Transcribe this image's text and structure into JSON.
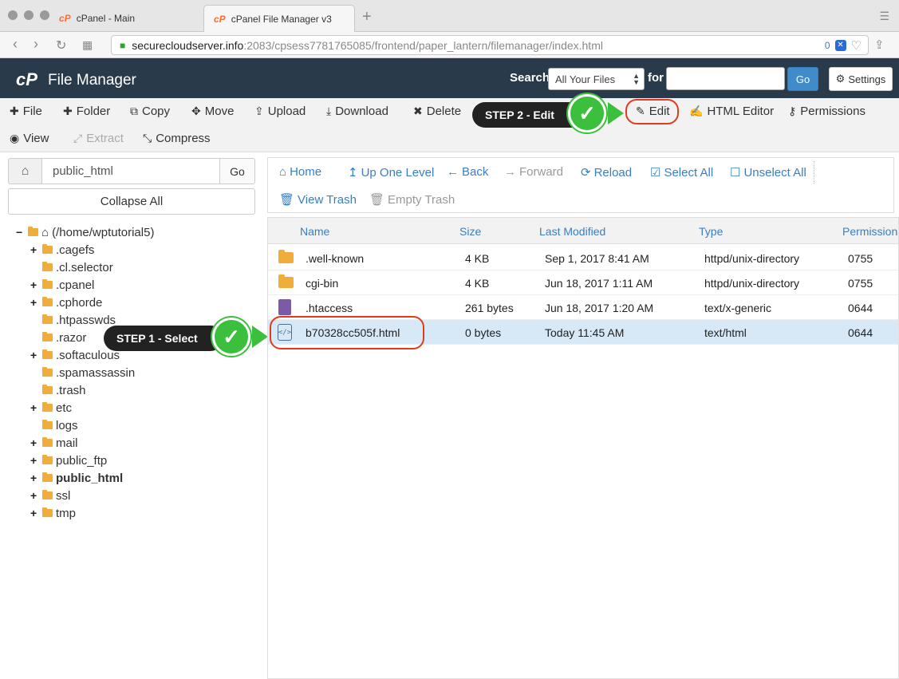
{
  "browser": {
    "tabs": [
      {
        "label": "cPanel - Main",
        "favicon": "cP"
      },
      {
        "label": "cPanel File Manager v3",
        "favicon": "cP",
        "close": "✕"
      }
    ],
    "new_tab": "+",
    "url_host": "securecloudserver.info",
    "url_path": ":2083/cpsess7781765085/frontend/paper_lantern/filemanager/index.html",
    "tracker_count": "0"
  },
  "header": {
    "logo": "cP",
    "title": "File Manager",
    "search_label": "Search",
    "search_scope": "All Your Files",
    "for_label": "for",
    "search_value": "",
    "go_label": "Go",
    "settings_label": "Settings"
  },
  "toolbar": {
    "file": "File",
    "folder": "Folder",
    "copy": "Copy",
    "move": "Move",
    "upload": "Upload",
    "download": "Download",
    "delete": "Delete",
    "edit": "Edit",
    "html_editor": "HTML Editor",
    "permissions": "Permissions",
    "view": "View",
    "extract": "Extract",
    "compress": "Compress"
  },
  "steps": {
    "step1": "STEP 1 - Select",
    "step2": "STEP 2 - Edit"
  },
  "left": {
    "path_value": "public_html",
    "go_label": "Go",
    "collapse_label": "Collapse All",
    "root": "(/home/wptutorial5)",
    "tree": [
      {
        "label": ".cagefs",
        "toggle": "+"
      },
      {
        "label": ".cl.selector",
        "toggle": ""
      },
      {
        "label": ".cpanel",
        "toggle": "+"
      },
      {
        "label": ".cphorde",
        "toggle": "+"
      },
      {
        "label": ".htpasswds",
        "toggle": ""
      },
      {
        "label": ".razor",
        "toggle": ""
      },
      {
        "label": ".softaculous",
        "toggle": "+"
      },
      {
        "label": ".spamassassin",
        "toggle": ""
      },
      {
        "label": ".trash",
        "toggle": ""
      },
      {
        "label": "etc",
        "toggle": "+"
      },
      {
        "label": "logs",
        "toggle": ""
      },
      {
        "label": "mail",
        "toggle": "+"
      },
      {
        "label": "public_ftp",
        "toggle": "+"
      },
      {
        "label": "public_html",
        "toggle": "+"
      },
      {
        "label": "ssl",
        "toggle": "+"
      },
      {
        "label": "tmp",
        "toggle": "+"
      }
    ]
  },
  "actions": {
    "home": "Home",
    "up": "Up One Level",
    "back": "Back",
    "forward": "Forward",
    "reload": "Reload",
    "select_all": "Select All",
    "unselect_all": "Unselect All",
    "view_trash": "View Trash",
    "empty_trash": "Empty Trash"
  },
  "table": {
    "columns": [
      "Name",
      "Size",
      "Last Modified",
      "Type",
      "Permissions"
    ],
    "rows": [
      {
        "name": ".well-known",
        "size": "4 KB",
        "modified": "Sep 1, 2017 8:41 AM",
        "type": "httpd/unix-directory",
        "perm": "0755",
        "icon": "folder-icon"
      },
      {
        "name": "cgi-bin",
        "size": "4 KB",
        "modified": "Jun 18, 2017 1:11 AM",
        "type": "httpd/unix-directory",
        "perm": "0755",
        "icon": "folder-icon"
      },
      {
        "name": ".htaccess",
        "size": "261 bytes",
        "modified": "Jun 18, 2017 1:20 AM",
        "type": "text/x-generic",
        "perm": "0644",
        "icon": "document-icon"
      },
      {
        "name": "b70328cc505f.html",
        "size": "0 bytes",
        "modified": "Today 11:45 AM",
        "type": "text/html",
        "perm": "0644",
        "icon": "html-file-icon"
      }
    ]
  },
  "colors": {
    "header_bg": "#293a4a",
    "accent": "#3a7ec2",
    "selected_row": "#d7e9f7",
    "callout_green": "#3cbf3c",
    "highlight_red": "#e23a1f"
  }
}
